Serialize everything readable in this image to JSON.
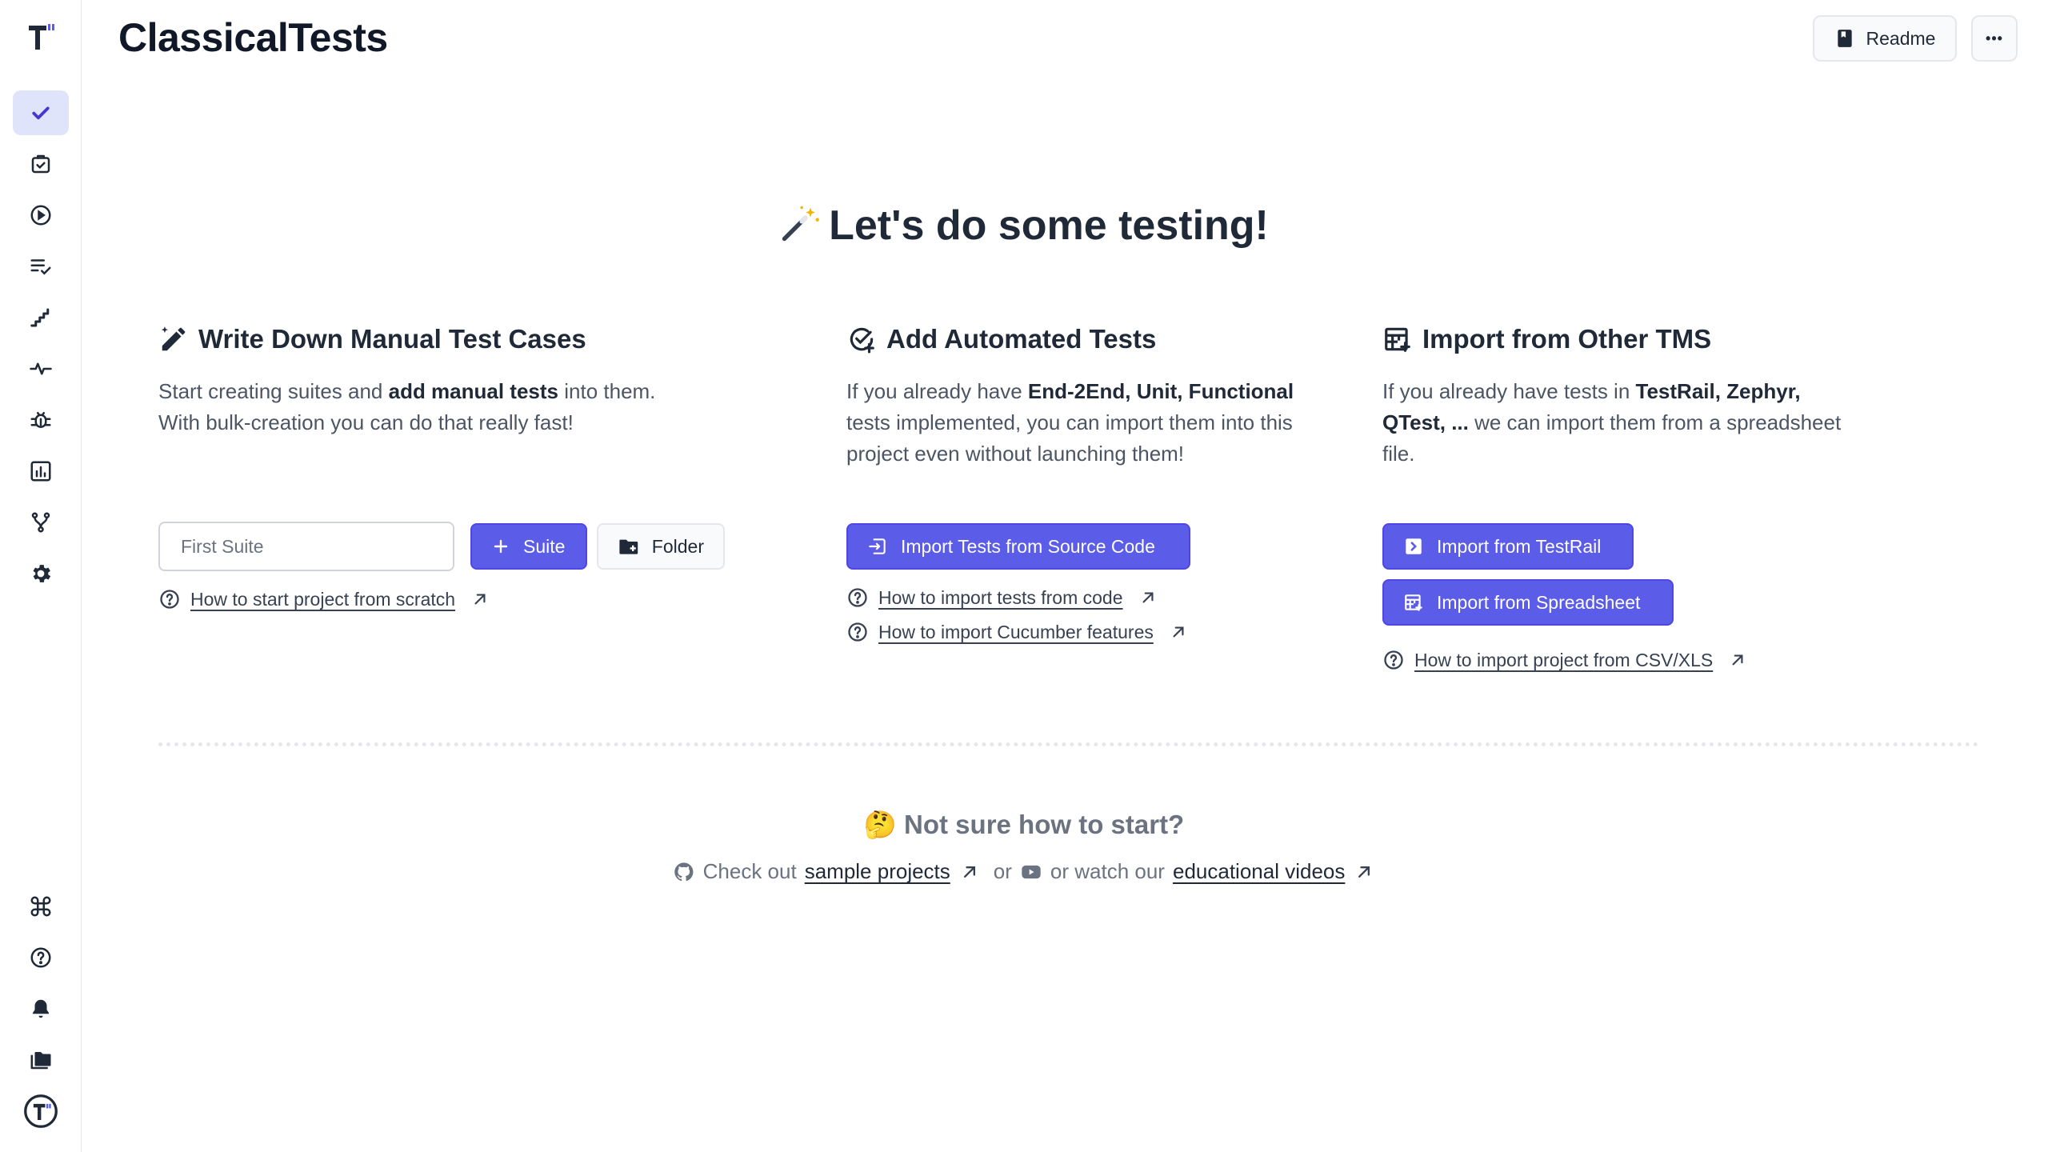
{
  "header": {
    "title": "ClassicalTests",
    "readme_label": "Readme",
    "more_label": "•••"
  },
  "sidebar": {
    "items": [
      {
        "name": "tests",
        "icon": "check-icon",
        "active": true
      },
      {
        "name": "plans",
        "icon": "clipboard-check-icon"
      },
      {
        "name": "runs",
        "icon": "play-circle-icon"
      },
      {
        "name": "checklist",
        "icon": "list-check-icon"
      },
      {
        "name": "steps",
        "icon": "stairs-icon"
      },
      {
        "name": "pulse",
        "icon": "pulse-icon"
      },
      {
        "name": "defects",
        "icon": "bug-icon"
      },
      {
        "name": "analytics",
        "icon": "bar-chart-icon"
      },
      {
        "name": "branches",
        "icon": "git-branch-icon"
      },
      {
        "name": "settings",
        "icon": "gear-icon"
      }
    ],
    "bottom_items": [
      {
        "name": "commands",
        "icon": "command-icon"
      },
      {
        "name": "help",
        "icon": "question-icon"
      },
      {
        "name": "notifications",
        "icon": "bell-icon"
      },
      {
        "name": "projects",
        "icon": "folders-icon"
      },
      {
        "name": "profile",
        "icon": "avatar-logo-icon"
      }
    ]
  },
  "hero": {
    "title": "Let's do some testing!"
  },
  "manual": {
    "title": "Write Down Manual Test Cases",
    "desc_1": "Start creating suites and ",
    "desc_bold": "add manual tests",
    "desc_2": " into them.",
    "desc_3": "With bulk-creation you can do that really fast!",
    "input_placeholder": "First Suite",
    "suite_button": "Suite",
    "folder_button": "Folder",
    "help_link": "How to start project from scratch"
  },
  "automated": {
    "title": "Add Automated Tests",
    "desc_1": "If you already have ",
    "desc_bold": "End-2End, Unit, Functional",
    "desc_2": " tests implemented, you can import them into this project even without launching them!",
    "import_button": "Import Tests from Source Code",
    "help_link_1": "How to import tests from code",
    "help_link_2": "How to import Cucumber features"
  },
  "import_tms": {
    "title": "Import from Other TMS",
    "desc_1": "If you already have tests in ",
    "desc_bold": "TestRail, Zephyr, QTest, ...",
    "desc_2": " we can import them from a spreadsheet file.",
    "testrail_button": "Import from TestRail",
    "spreadsheet_button": "Import from Spreadsheet",
    "help_link": "How to import project from CSV/XLS"
  },
  "footer": {
    "not_sure": "🤔 Not sure how to start?",
    "check_out": "Check out",
    "sample_projects": "sample projects",
    "or": "or",
    "or_watch": "or watch our",
    "educational_videos": "educational videos"
  },
  "colors": {
    "accent": "#5b5ce8",
    "sidebar_active_bg": "#e0e4fb",
    "icon": "#1f2937"
  }
}
